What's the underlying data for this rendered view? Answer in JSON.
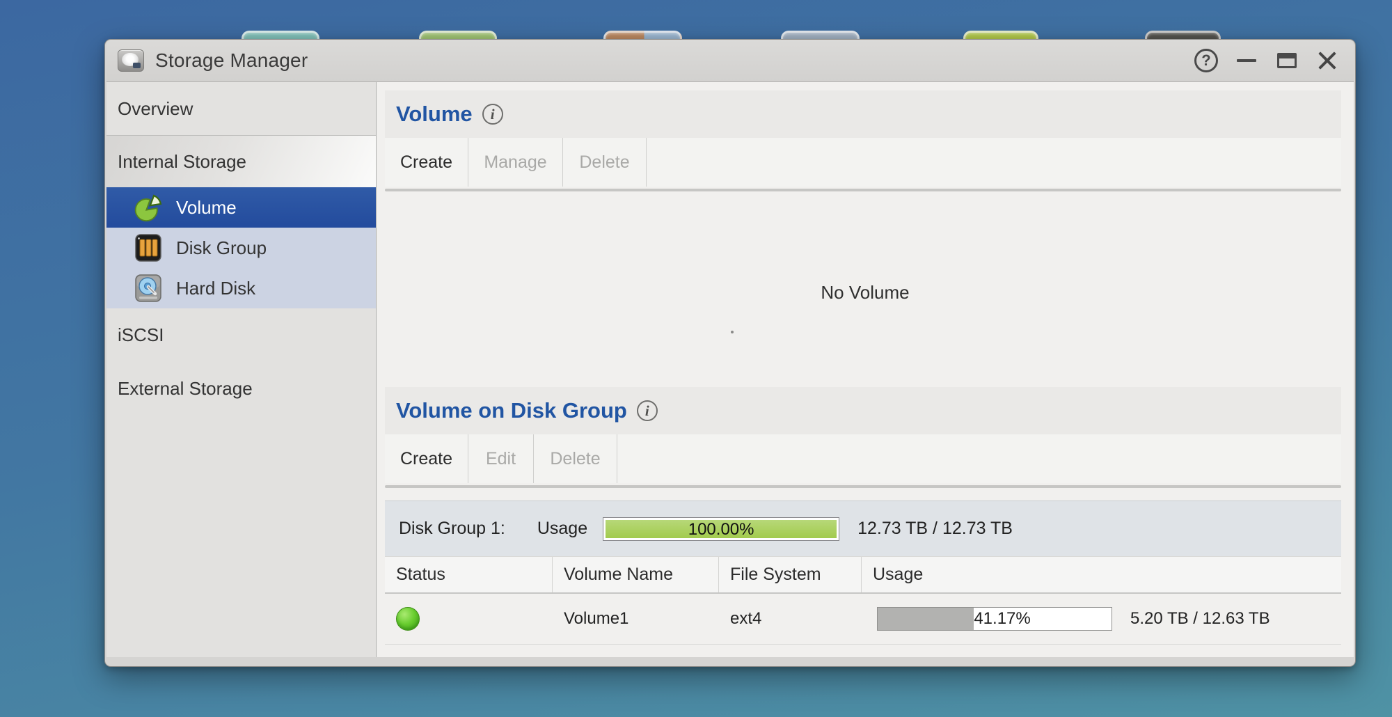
{
  "window": {
    "title": "Storage Manager",
    "icons": {
      "help_glyph": "?",
      "info_glyph": "i"
    }
  },
  "desktop": {
    "icons": [
      {
        "name": "teal-app",
        "color": "#82c2ba"
      },
      {
        "name": "green-app",
        "color": "#a2c675"
      },
      {
        "name": "orange-blue-app",
        "color": "linear-gradient(90deg,#bd8a62 0 52%,#9db8d2 52%)"
      },
      {
        "name": "grayblue-app",
        "color": "#a3b3c4"
      },
      {
        "name": "yellowgreen-app",
        "color": "#b3ca4b"
      },
      {
        "name": "dark-app",
        "color": "#55544f"
      }
    ]
  },
  "sidebar": {
    "overview": "Overview",
    "internal_storage": "Internal Storage",
    "items": [
      {
        "label": "Volume",
        "icon": "pie-chart-icon",
        "selected": true
      },
      {
        "label": "Disk Group",
        "icon": "disk-array-icon",
        "selected": false
      },
      {
        "label": "Hard Disk",
        "icon": "hard-disk-icon",
        "selected": false
      }
    ],
    "iscsi": "iSCSI",
    "external_storage": "External Storage"
  },
  "volume_section": {
    "title": "Volume",
    "toolbar": [
      {
        "label": "Create",
        "state": "enabled"
      },
      {
        "label": "Manage",
        "state": "disabled"
      },
      {
        "label": "Delete",
        "state": "disabled"
      }
    ],
    "empty_message": "No Volume"
  },
  "volume_on_disk_group": {
    "title": "Volume on Disk Group",
    "toolbar": [
      {
        "label": "Create",
        "state": "enabled"
      },
      {
        "label": "Edit",
        "state": "disabled"
      },
      {
        "label": "Delete",
        "state": "disabled"
      }
    ],
    "disk_group": {
      "name": "Disk Group 1:",
      "usage_label": "Usage",
      "usage_percent": "100.00%",
      "usage_value": 100,
      "capacity": "12.73 TB / 12.73 TB"
    },
    "table": {
      "columns": [
        "Status",
        "Volume Name",
        "File System",
        "Usage"
      ],
      "rows": [
        {
          "status": "normal",
          "volume_name": "Volume1",
          "file_system": "ext4",
          "usage_percent": "41.17%",
          "usage_value": 41.17,
          "size": "5.20 TB / 12.63 TB"
        }
      ]
    }
  },
  "colors": {
    "accent_blue": "#2155a3",
    "selected_item_blue": "#2a52a1",
    "disk_group_bar_green": "#a9cf5a",
    "status_led_green": "#5cc12e",
    "row_usage_gray": "#b2b2b0"
  }
}
